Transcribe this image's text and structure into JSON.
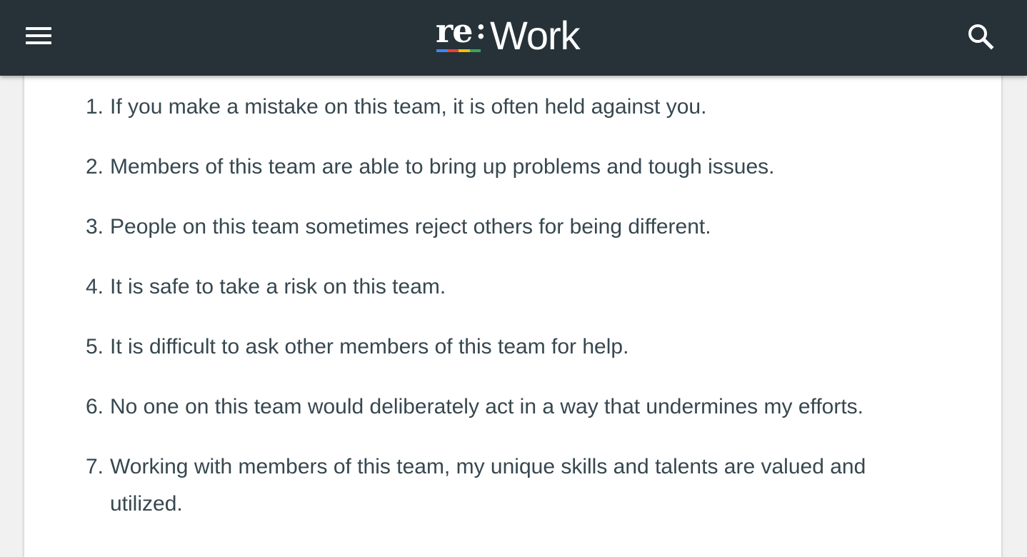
{
  "header": {
    "logo_re": "re",
    "logo_colon": ":",
    "logo_work": "Work",
    "logo_bar_colors": [
      "#4285f4",
      "#ea4335",
      "#fbbc05",
      "#34a853"
    ],
    "menu_icon": "hamburger-menu-icon",
    "search_icon": "search-icon",
    "background": "#263238"
  },
  "questions": [
    {
      "num": "1.",
      "text": "If you make a mistake on this team, it is often held against you."
    },
    {
      "num": "2.",
      "text": "Members of this team are able to bring up problems and tough issues."
    },
    {
      "num": "3.",
      "text": "People on this team sometimes reject others for being different."
    },
    {
      "num": "4.",
      "text": "It is safe to take a risk on this team."
    },
    {
      "num": "5.",
      "text": "It is difficult to ask other members of this team for help."
    },
    {
      "num": "6.",
      "text": "No one on this team would deliberately act in a way that undermines my efforts."
    },
    {
      "num": "7.",
      "text": "Working with members of this team, my unique skills and talents are valued and utilized."
    }
  ]
}
